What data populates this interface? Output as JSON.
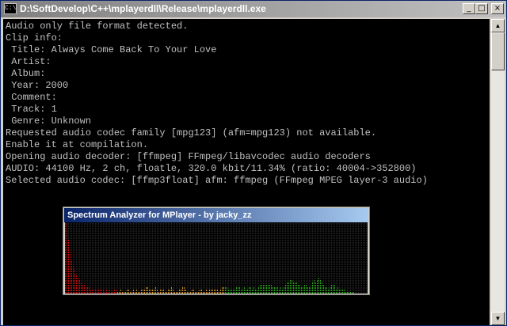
{
  "window": {
    "title": "D:\\SoftDevelop\\C++\\mplayerdll\\Release\\mplayerdll.exe",
    "icon": "console-app-icon",
    "icon_text": "C:\\",
    "buttons": {
      "minimize": "_",
      "maximize": "□",
      "close": "×"
    }
  },
  "console": {
    "lines": [
      "Audio only file format detected.",
      "Clip info:",
      " Title: Always Come Back To Your Love",
      " Artist:",
      " Album:",
      " Year: 2000",
      " Comment:",
      " Track: 1",
      " Genre: Unknown",
      "Requested audio codec family [mpg123] (afm=mpg123) not available.",
      "Enable it at compilation.",
      "Opening audio decoder: [ffmpeg] FFmpeg/libavcodec audio decoders",
      "AUDIO: 44100 Hz, 2 ch, floatle, 320.0 kbit/11.34% (ratio: 40004->352800)",
      "Selected audio codec: [ffmp3float] afm: ffmpeg (FFmpeg MPEG layer-3 audio)"
    ],
    "text_color": "#c0c0c0",
    "background": "#000000"
  },
  "scrollbar": {
    "up": "▲",
    "down": "▼"
  },
  "spectrum": {
    "title": "Spectrum Analyzer for MPlayer - by jacky_zz",
    "max_level": 33,
    "levels": [
      33,
      30,
      23,
      18,
      14,
      12,
      10,
      8,
      7,
      6,
      5,
      4,
      4,
      3,
      3,
      3,
      2,
      2,
      2,
      2,
      2,
      2,
      2,
      2,
      2,
      1,
      2,
      1,
      2,
      1,
      1,
      2,
      2,
      1,
      1,
      2,
      1,
      1,
      1,
      2,
      2,
      1,
      1,
      2,
      1,
      2,
      1,
      1,
      2,
      2,
      2,
      3,
      3,
      2,
      2,
      2,
      2,
      3,
      2,
      1,
      2,
      2,
      2,
      1,
      1,
      2,
      2,
      3,
      2,
      1,
      1,
      1,
      2,
      2,
      3,
      3,
      2,
      1,
      1,
      1,
      2,
      2,
      1,
      1,
      1,
      2,
      2,
      1,
      1,
      2,
      1,
      2,
      2,
      2,
      2,
      2,
      2,
      1,
      2,
      3,
      3,
      3,
      3,
      2,
      2,
      2,
      2,
      2,
      3,
      3,
      3,
      2,
      2,
      3,
      2,
      2,
      3,
      3,
      2,
      3,
      2,
      2,
      3,
      4,
      4,
      4,
      4,
      4,
      4,
      4,
      4,
      3,
      3,
      3,
      3,
      2,
      3,
      2,
      3,
      4,
      5,
      5,
      6,
      6,
      5,
      5,
      5,
      4,
      4,
      3,
      3,
      4,
      4,
      3,
      3,
      3,
      5,
      6,
      5,
      6,
      7,
      6,
      5,
      4,
      3,
      3,
      2,
      3,
      4,
      4,
      4,
      2,
      3,
      2,
      2,
      2,
      2,
      1,
      1,
      1,
      1,
      1,
      1
    ],
    "colors": {
      "low": "#c81414",
      "mid": "#d49828",
      "high": "#2ea820",
      "grid": "#222222"
    }
  }
}
